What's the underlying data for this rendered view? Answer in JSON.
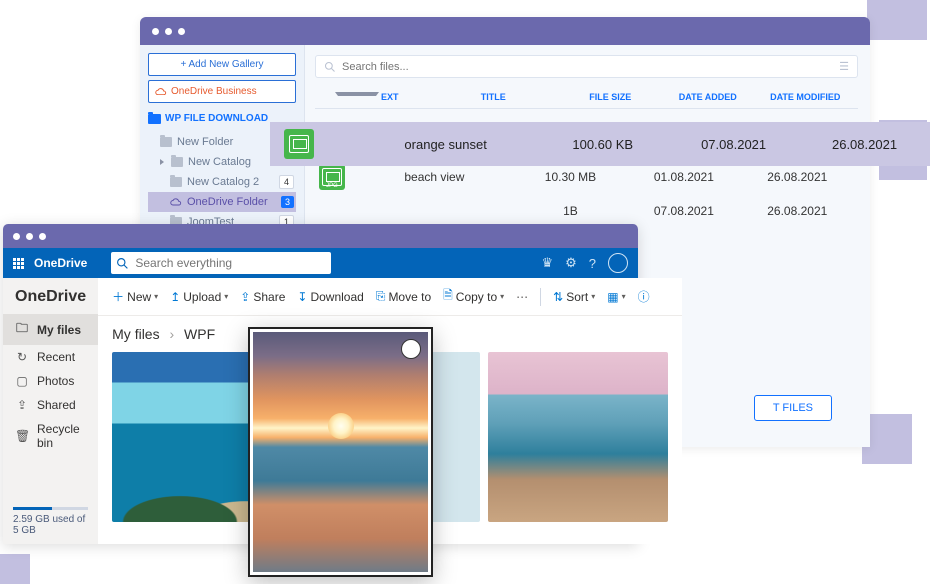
{
  "wp": {
    "add_gallery": "+  Add New Gallery",
    "onedrive_biz": "OneDrive Business",
    "title": "WP FILE DOWNLOAD",
    "tree": [
      {
        "label": "New Folder"
      },
      {
        "label": "New Catalog"
      },
      {
        "label": "New Catalog 2",
        "badge": "4"
      },
      {
        "label": "OneDrive Folder",
        "badge": "3",
        "selected": true
      },
      {
        "label": "JoomTest",
        "badge": "1"
      }
    ],
    "search_placeholder": "Search files...",
    "columns": {
      "ext": "EXT",
      "title": "TITLE",
      "size": "FILE SIZE",
      "added": "DATE ADDED",
      "modified": "DATE MODIFIED"
    },
    "rows": [
      {
        "title": "orange sunset",
        "size": "100.60 KB",
        "added": "07.08.2021",
        "modified": "26.08.2021",
        "highlighted": true
      },
      {
        "title": "beach view",
        "size": "10.30 MB",
        "added": "01.08.2021",
        "modified": "26.08.2021",
        "chip": "JPG"
      },
      {
        "title": "",
        "size": "1B",
        "added": "07.08.2021",
        "modified": "26.08.2021"
      }
    ],
    "select_files": "T FILES"
  },
  "onedrive": {
    "brand": "OneDrive",
    "search_placeholder": "Search everything",
    "sidebar_title": "OneDrive",
    "sidebar": [
      {
        "label": "My files",
        "active": true
      },
      {
        "label": "Recent"
      },
      {
        "label": "Photos"
      },
      {
        "label": "Shared"
      },
      {
        "label": "Recycle bin"
      }
    ],
    "storage": "2.59 GB used of 5 GB",
    "toolbar": {
      "new": "New",
      "upload": "Upload",
      "share": "Share",
      "download": "Download",
      "moveto": "Move to",
      "copyto": "Copy to",
      "sort": "Sort"
    },
    "breadcrumb": {
      "root": "My files",
      "current": "WPF"
    }
  }
}
